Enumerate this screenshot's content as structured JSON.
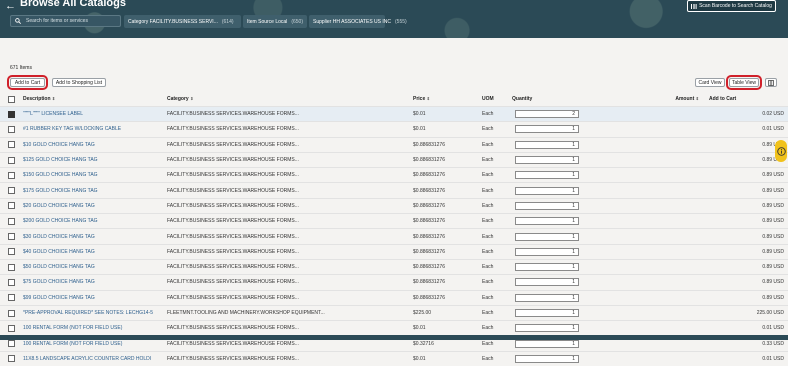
{
  "header": {
    "back": "←",
    "title": "Browse All Catalogs",
    "scan_label": "Scan Barcode to Search Catalog",
    "search_placeholder": "Search for items or services",
    "chips": [
      {
        "label": "Category FACILITY.BUSINESS SERVI...",
        "count": "(614)"
      },
      {
        "label": "Item Source Local",
        "count": "(650)"
      },
      {
        "label": "Supplier HH ASSOCIATES US INC",
        "count": "(555)"
      }
    ]
  },
  "toolbar": {
    "items_count": "671 Items",
    "add_to_cart": "Add to Cart",
    "add_to_list": "Add to Shopping List",
    "card_view": "Card View",
    "table_view": "Table View"
  },
  "columns": {
    "description": "Description",
    "category": "Category",
    "price": "Price",
    "uom": "UOM",
    "quantity": "Quantity",
    "amount": "Amount",
    "add_to_cart": "Add to Cart"
  },
  "rows": [
    {
      "selected": true,
      "description": "\"\"\"\"L\"\"\"\" LICENSEE LABEL",
      "category": "FACILITY.BUSINESS SERVICES.WAREHOUSE FORMS...",
      "price": "$0.01",
      "uom": "Each",
      "quantity": "2",
      "amount": "0.02 USD"
    },
    {
      "selected": false,
      "description": "#1 RUBBER KEY TAG W/LOCKING CABLE",
      "category": "FACILITY.BUSINESS SERVICES.WAREHOUSE FORMS...",
      "price": "$0.01",
      "uom": "Each",
      "quantity": "1",
      "amount": "0.01 USD"
    },
    {
      "selected": false,
      "description": "$10 GOLD CHOICE HANG TAG",
      "category": "FACILITY.BUSINESS SERVICES.WAREHOUSE FORMS...",
      "price": "$0.886831276",
      "uom": "Each",
      "quantity": "1",
      "amount": "0.89 USD"
    },
    {
      "selected": false,
      "description": "$125 GOLD CHOICE HANG TAG",
      "category": "FACILITY.BUSINESS SERVICES.WAREHOUSE FORMS...",
      "price": "$0.886831276",
      "uom": "Each",
      "quantity": "1",
      "amount": "0.89 USD"
    },
    {
      "selected": false,
      "description": "$150 GOLD CHOICE HANG TAG",
      "category": "FACILITY.BUSINESS SERVICES.WAREHOUSE FORMS...",
      "price": "$0.886831276",
      "uom": "Each",
      "quantity": "1",
      "amount": "0.89 USD"
    },
    {
      "selected": false,
      "description": "$175 GOLD CHOICE HANG TAG",
      "category": "FACILITY.BUSINESS SERVICES.WAREHOUSE FORMS...",
      "price": "$0.886831276",
      "uom": "Each",
      "quantity": "1",
      "amount": "0.89 USD"
    },
    {
      "selected": false,
      "description": "$20 GOLD CHOICE HANG TAG",
      "category": "FACILITY.BUSINESS SERVICES.WAREHOUSE FORMS...",
      "price": "$0.886831276",
      "uom": "Each",
      "quantity": "1",
      "amount": "0.89 USD"
    },
    {
      "selected": false,
      "description": "$200 GOLD CHOICE HANG TAG",
      "category": "FACILITY.BUSINESS SERVICES.WAREHOUSE FORMS...",
      "price": "$0.886831276",
      "uom": "Each",
      "quantity": "1",
      "amount": "0.89 USD"
    },
    {
      "selected": false,
      "description": "$30 GOLD CHOICE HANG TAG",
      "category": "FACILITY.BUSINESS SERVICES.WAREHOUSE FORMS...",
      "price": "$0.886831276",
      "uom": "Each",
      "quantity": "1",
      "amount": "0.89 USD"
    },
    {
      "selected": false,
      "description": "$40 GOLD CHOICE HANG TAG",
      "category": "FACILITY.BUSINESS SERVICES.WAREHOUSE FORMS...",
      "price": "$0.886831276",
      "uom": "Each",
      "quantity": "1",
      "amount": "0.89 USD"
    },
    {
      "selected": false,
      "description": "$50 GOLD CHOICE HANG TAG",
      "category": "FACILITY.BUSINESS SERVICES.WAREHOUSE FORMS...",
      "price": "$0.886831276",
      "uom": "Each",
      "quantity": "1",
      "amount": "0.89 USD"
    },
    {
      "selected": false,
      "description": "$75 GOLD CHOICE HANG TAG",
      "category": "FACILITY.BUSINESS SERVICES.WAREHOUSE FORMS...",
      "price": "$0.886831276",
      "uom": "Each",
      "quantity": "1",
      "amount": "0.89 USD"
    },
    {
      "selected": false,
      "description": "$99 GOLD CHOICE HANG TAG",
      "category": "FACILITY.BUSINESS SERVICES.WAREHOUSE FORMS...",
      "price": "$0.886831276",
      "uom": "Each",
      "quantity": "1",
      "amount": "0.89 USD"
    },
    {
      "selected": false,
      "description": "*PRE-APPROVAL REQUIRED* SEE NOTES: LECHG14-5",
      "category": "FLEETMNT.TOOLING AND MACHINERY.WORKSHOP EQUIPMENT...",
      "price": "$225.00",
      "uom": "Each",
      "quantity": "1",
      "amount": "225.00 USD"
    },
    {
      "selected": false,
      "description": "100 RENTAL FORM (NOT FOR FIELD USE)",
      "category": "FACILITY.BUSINESS SERVICES.WAREHOUSE FORMS...",
      "price": "$0.01",
      "uom": "Each",
      "quantity": "1",
      "amount": "0.01 USD"
    },
    {
      "selected": false,
      "description": "100 RENTAL FORM (NOT FOR FIELD USE)",
      "category": "FACILITY.BUSINESS SERVICES.WAREHOUSE FORMS...",
      "price": "$0.32716",
      "uom": "Each",
      "quantity": "1",
      "amount": "0.33 USD"
    },
    {
      "selected": false,
      "description": "11X8.5 LANDSCAPE ACRYLIC COUNTER CARD HOLDI",
      "category": "FACILITY.BUSINESS SERVICES.WAREHOUSE FORMS...",
      "price": "$0.01",
      "uom": "Each",
      "quantity": "1",
      "amount": "0.01 USD"
    }
  ],
  "icons": {
    "back": "arrow-left-icon",
    "scan": "barcode-icon",
    "search": "search-icon",
    "sort": "sort-icon",
    "cart": "cart-icon",
    "grid": "grid-view-icon",
    "help": "help-icon"
  },
  "colors": {
    "header_bg": "#2b4a56",
    "link": "#2c5e8c",
    "highlight": "#d0202a",
    "selected_row": "#e6edf3",
    "help_badge": "#f1c21b"
  }
}
